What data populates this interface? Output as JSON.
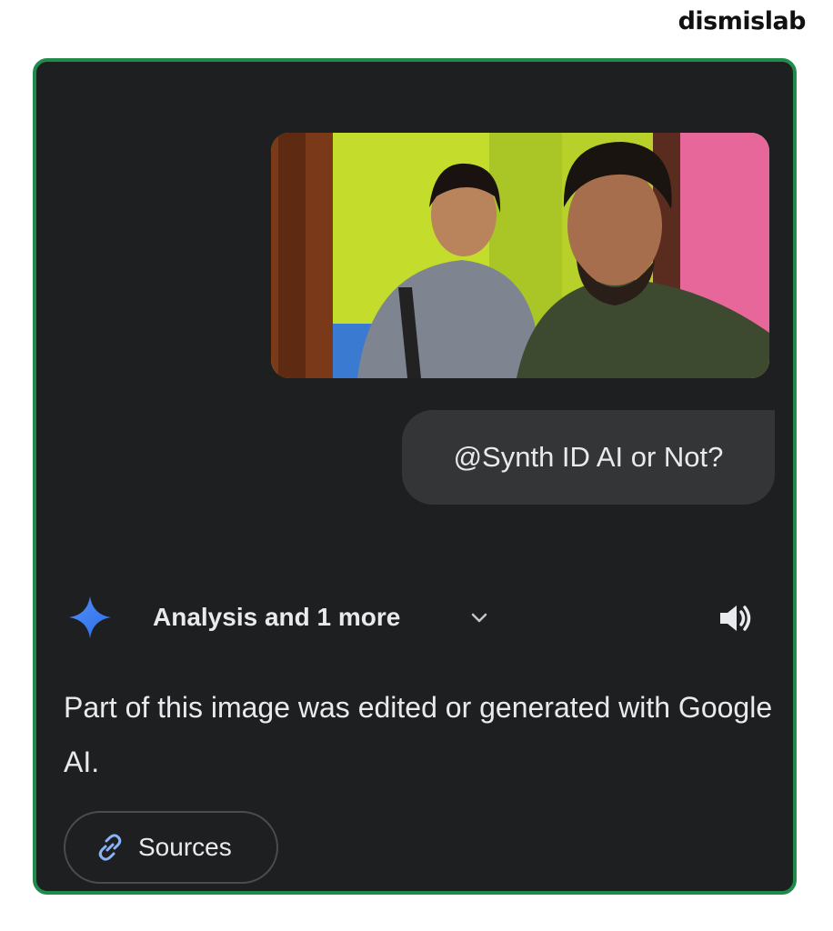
{
  "brand": {
    "logo_text": "dismislab"
  },
  "chat": {
    "user_prompt": "@Synth ID AI or Not?",
    "response": {
      "thought_summary": "Analysis and 1 more",
      "text": "Part of this image was edited or generated with Google AI.",
      "sources_label": "Sources"
    }
  },
  "icons": {
    "assistant": "gemini-sparkle-icon",
    "expand": "chevron-down-icon",
    "read_aloud": "speaker-icon",
    "sources": "link-icon"
  },
  "colors": {
    "card_background": "#1e1f21",
    "card_border": "#1f8a4a",
    "bubble_background": "#333537",
    "text": "#e8eaed",
    "accent_blue": "#4285f4"
  }
}
